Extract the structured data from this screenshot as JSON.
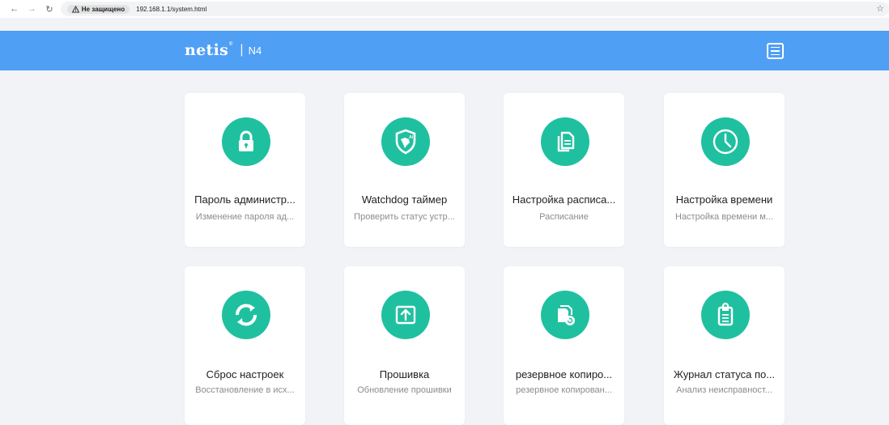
{
  "browser": {
    "security_label": "Не защищено",
    "url": "192.168.1.1/system.html"
  },
  "header": {
    "logo": "netis",
    "separator": "|",
    "model": "N4"
  },
  "colors": {
    "header_bg": "#4f9ff5",
    "icon_bg": "#1fc0a0",
    "page_bg": "#f1f3f6"
  },
  "cards": [
    {
      "icon": "lock-icon",
      "title": "Пароль администр...",
      "subtitle": "Изменение пароля ад..."
    },
    {
      "icon": "watchdog-shield-icon",
      "title": "Watchdog таймер",
      "subtitle": "Проверить статус устр..."
    },
    {
      "icon": "schedule-document-icon",
      "title": "Настройка расписа...",
      "subtitle": "Расписание"
    },
    {
      "icon": "clock-icon",
      "title": "Настройка времени",
      "subtitle": "Настройка времени м..."
    },
    {
      "icon": "reset-arrows-icon",
      "title": "Сброс настроек",
      "subtitle": "Восстановление в исх..."
    },
    {
      "icon": "firmware-upload-icon",
      "title": "Прошивка",
      "subtitle": "Обновление прошивки"
    },
    {
      "icon": "backup-icon",
      "title": "резервное копиро...",
      "subtitle": "резервное копирован..."
    },
    {
      "icon": "clipboard-log-icon",
      "title": "Журнал статуса по...",
      "subtitle": "Анализ неисправност..."
    }
  ]
}
